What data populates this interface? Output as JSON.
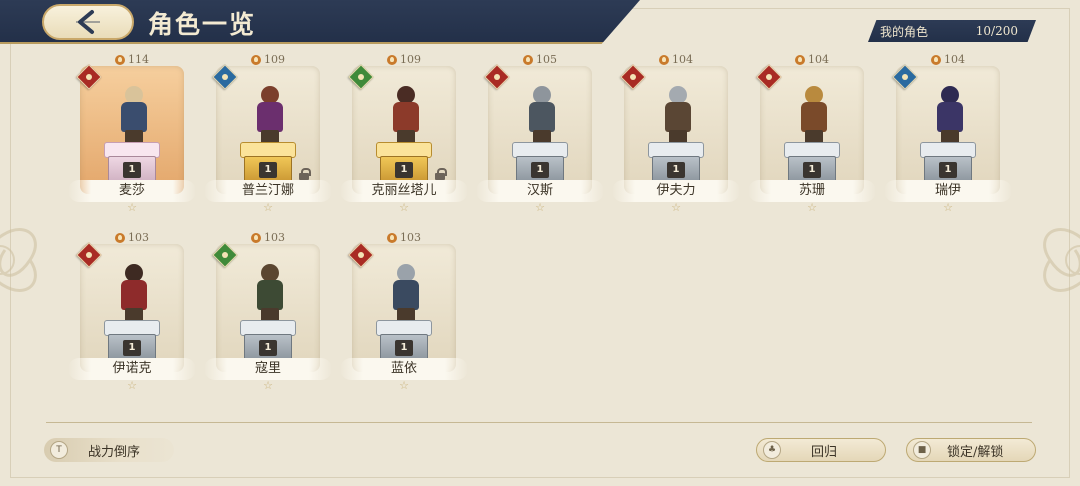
{
  "header": {
    "title": "角色一览"
  },
  "counter": {
    "label": "我的角色",
    "value": "10/200"
  },
  "characters": [
    {
      "name": "麦莎",
      "power": "114",
      "level": "1",
      "element": "red",
      "pedestal": "pink",
      "highlight": true,
      "locked": false,
      "hair": "#d9c39a",
      "outfit": "#3a4d6e"
    },
    {
      "name": "普兰汀娜",
      "power": "109",
      "level": "1",
      "element": "blue",
      "pedestal": "gold",
      "highlight": false,
      "locked": true,
      "hair": "#7b3f2c",
      "outfit": "#6b2f6e"
    },
    {
      "name": "克丽丝塔儿",
      "power": "109",
      "level": "1",
      "element": "green",
      "pedestal": "gold",
      "highlight": false,
      "locked": true,
      "hair": "#4a2c24",
      "outfit": "#8c3a2a"
    },
    {
      "name": "汉斯",
      "power": "105",
      "level": "1",
      "element": "red",
      "pedestal": "grey",
      "highlight": false,
      "locked": false,
      "hair": "#8e959c",
      "outfit": "#4c5660"
    },
    {
      "name": "伊夫力",
      "power": "104",
      "level": "1",
      "element": "red",
      "pedestal": "grey",
      "highlight": false,
      "locked": false,
      "hair": "#a4aab0",
      "outfit": "#5a4634"
    },
    {
      "name": "苏珊",
      "power": "104",
      "level": "1",
      "element": "red",
      "pedestal": "grey",
      "highlight": false,
      "locked": false,
      "hair": "#b98a3e",
      "outfit": "#7a4a2a"
    },
    {
      "name": "瑞伊",
      "power": "104",
      "level": "1",
      "element": "blue",
      "pedestal": "grey",
      "highlight": false,
      "locked": false,
      "hair": "#2e2a52",
      "outfit": "#3b3566"
    },
    {
      "name": "伊诺克",
      "power": "103",
      "level": "1",
      "element": "red",
      "pedestal": "grey",
      "highlight": false,
      "locked": false,
      "hair": "#3e2a22",
      "outfit": "#8e2b2b"
    },
    {
      "name": "寇里",
      "power": "103",
      "level": "1",
      "element": "green",
      "pedestal": "grey",
      "highlight": false,
      "locked": false,
      "hair": "#5b4630",
      "outfit": "#3d4a34"
    },
    {
      "name": "蓝依",
      "power": "103",
      "level": "1",
      "element": "red",
      "pedestal": "grey",
      "highlight": false,
      "locked": false,
      "hair": "#9aa2aa",
      "outfit": "#3a4a60"
    }
  ],
  "footer": {
    "sort_label": "战力倒序",
    "return_label": "回归",
    "lock_label": "锁定/解锁"
  },
  "colors": {
    "header_bg": "#2d3b55",
    "background": "#ece6d6",
    "accent_gold": "#c9a86a"
  }
}
